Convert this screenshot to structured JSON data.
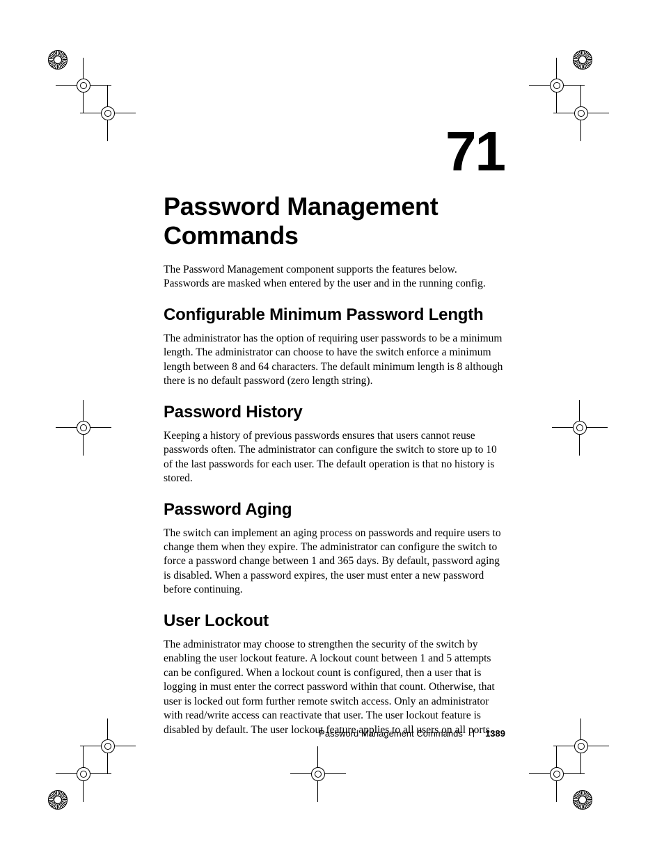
{
  "chapter": {
    "number": "71",
    "title": "Password Management Commands",
    "intro": "The Password Management component supports the features below. Passwords are masked when entered by the user and in the running config."
  },
  "sections": [
    {
      "heading": "Configurable Minimum Password Length",
      "body": "The administrator has the option of requiring user passwords to be a minimum length. The administrator can choose to have the switch enforce a minimum length between 8 and 64 characters. The default minimum length is 8 although there is no default password (zero length string)."
    },
    {
      "heading": "Password History",
      "body": "Keeping a history of previous passwords ensures that users cannot reuse passwords often. The administrator can configure the switch to store up to 10 of the last passwords for each user. The default operation is that no history is stored."
    },
    {
      "heading": "Password Aging",
      "body": "The switch can implement an aging process on passwords and require users to change them when they expire. The administrator can configure the switch to force a password change between 1 and 365 days. By default, password aging is disabled. When a password expires, the user must enter a new password before continuing."
    },
    {
      "heading": "User Lockout",
      "body": "The administrator may choose to strengthen the security of the switch by enabling the user lockout feature. A lockout count between 1 and 5 attempts can be configured. When a lockout count is configured, then a user that is logging in must enter the correct password within that count. Otherwise, that user is locked out form further remote switch access. Only an administrator with read/write access can reactivate that user. The user lockout feature is disabled by default. The user lockout feature applies to all users on all ports."
    }
  ],
  "footer": {
    "section_label": "Password Management Commands",
    "page_number": "1389"
  }
}
